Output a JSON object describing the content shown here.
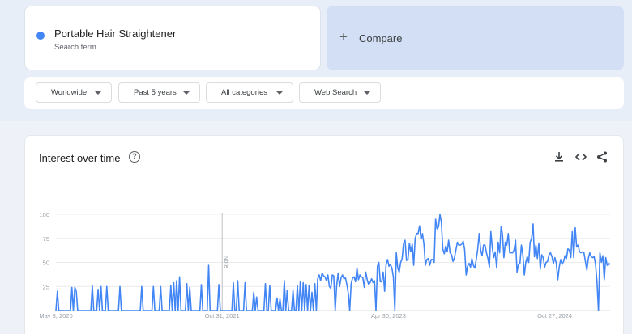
{
  "search_term": {
    "name": "Portable Hair Straightener",
    "sublabel": "Search term",
    "color": "#4285f4"
  },
  "compare": {
    "label": "Compare"
  },
  "filters": [
    {
      "label": "Worldwide"
    },
    {
      "label": "Past 5 years"
    },
    {
      "label": "All categories"
    },
    {
      "label": "Web Search"
    }
  ],
  "chart_card": {
    "title": "Interest over time",
    "icons": [
      "help-icon",
      "download-icon",
      "embed-icon",
      "share-icon"
    ]
  },
  "chart_data": {
    "type": "line",
    "title": "Interest over time",
    "xlabel": "",
    "ylabel": "",
    "ylim": [
      0,
      100
    ],
    "yticks": [
      25,
      50,
      75,
      100
    ],
    "x_tick_labels": [
      "May 3, 2020",
      "Oct 31, 2021",
      "Apr 30, 2023",
      "Oct 27, 2024"
    ],
    "x_tick_dates": [
      "2020-05-03",
      "2021-10-31",
      "2023-04-30",
      "2024-10-27"
    ],
    "x_start": "2020-05-03",
    "x_end": "2025-04-27",
    "annotation": {
      "label": "Note",
      "date": "2021-10-31"
    },
    "grid": true,
    "legend": "none",
    "series": [
      {
        "color": "#4285f4",
        "values": [
          0,
          20,
          0,
          0,
          0,
          0,
          0,
          0,
          0,
          0,
          0,
          24,
          0,
          24,
          20,
          0,
          0,
          0,
          0,
          0,
          0,
          0,
          0,
          0,
          0,
          26,
          0,
          0,
          0,
          22,
          0,
          25,
          0,
          0,
          0,
          25,
          0,
          0,
          0,
          0,
          0,
          0,
          0,
          0,
          25,
          0,
          0,
          0,
          0,
          0,
          0,
          0,
          0,
          0,
          0,
          0,
          0,
          0,
          0,
          25,
          0,
          0,
          0,
          0,
          0,
          0,
          0,
          25,
          0,
          0,
          0,
          0,
          25,
          0,
          0,
          0,
          0,
          0,
          0,
          26,
          0,
          29,
          0,
          31,
          0,
          35,
          0,
          0,
          0,
          0,
          28,
          0,
          24,
          0,
          0,
          0,
          0,
          0,
          0,
          0,
          27,
          0,
          0,
          0,
          0,
          47,
          0,
          0,
          0,
          0,
          0,
          0,
          27,
          0,
          0,
          0,
          0,
          0,
          0,
          0,
          0,
          0,
          29,
          0,
          0,
          31,
          0,
          0,
          0,
          0,
          29,
          0,
          0,
          0,
          0,
          0,
          19,
          0,
          14,
          0,
          0,
          0,
          0,
          0,
          28,
          0,
          0,
          26,
          0,
          0,
          0,
          0,
          13,
          0,
          12,
          0,
          0,
          31,
          0,
          21,
          0,
          0,
          0,
          21,
          0,
          0,
          26,
          0,
          30,
          0,
          29,
          0,
          27,
          0,
          26,
          0,
          19,
          0,
          28,
          0,
          33,
          37,
          31,
          39,
          36,
          35,
          31,
          37,
          25,
          23,
          37,
          36,
          0,
          26,
          39,
          25,
          34,
          37,
          33,
          34,
          27,
          18,
          0,
          28,
          34,
          35,
          30,
          44,
          32,
          37,
          35,
          34,
          24,
          40,
          32,
          27,
          29,
          33,
          29,
          31,
          0,
          46,
          50,
          30,
          30,
          40,
          20,
          48,
          53,
          46,
          48,
          44,
          35,
          0,
          60,
          44,
          40,
          50,
          54,
          70,
          73,
          52,
          53,
          70,
          61,
          69,
          47,
          75,
          80,
          80,
          88,
          74,
          80,
          69,
          47,
          53,
          54,
          47,
          53,
          53,
          50,
          95,
          85,
          87,
          100,
          92,
          64,
          59,
          67,
          61,
          73,
          60,
          58,
          51,
          55,
          63,
          71,
          68,
          68,
          69,
          72,
          63,
          37,
          46,
          49,
          45,
          54,
          47,
          44,
          53,
          64,
          80,
          63,
          57,
          68,
          68,
          60,
          54,
          45,
          82,
          65,
          55,
          61,
          44,
          71,
          60,
          87,
          80,
          55,
          71,
          68,
          80,
          60,
          60,
          60,
          63,
          73,
          40,
          48,
          49,
          68,
          58,
          37,
          50,
          56,
          50,
          71,
          75,
          90,
          56,
          68,
          54,
          70,
          43,
          58,
          55,
          45,
          50,
          51,
          58,
          60,
          56,
          49,
          55,
          49,
          32,
          45,
          53,
          48,
          51,
          57,
          54,
          64,
          63,
          55,
          82,
          55,
          86,
          66,
          68,
          61,
          60,
          61,
          60,
          51,
          42,
          54,
          60,
          56,
          55,
          56,
          48,
          30,
          0,
          60,
          50,
          57,
          32,
          55,
          47,
          49,
          48
        ]
      }
    ]
  }
}
